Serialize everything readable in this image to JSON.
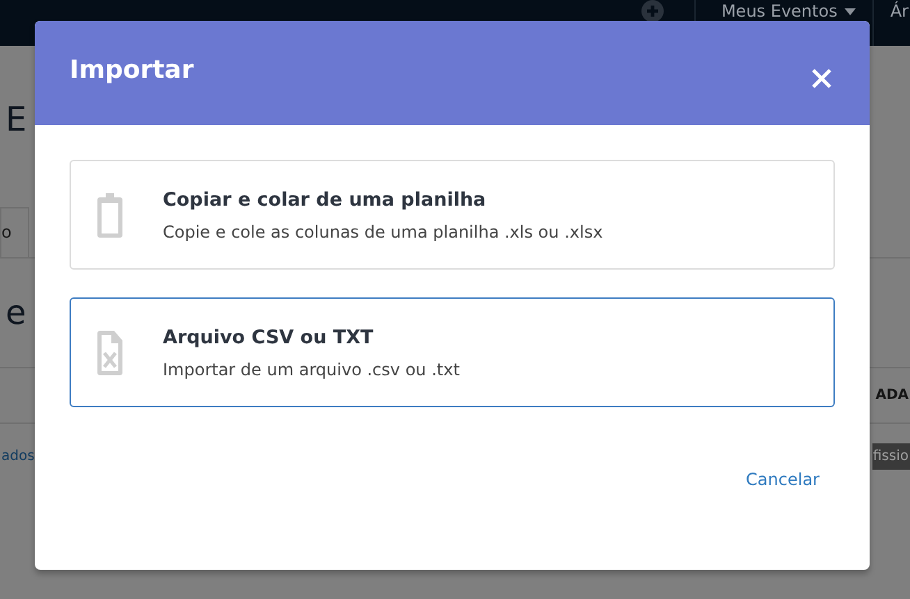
{
  "navbar": {
    "menu_label": "Meus Eventos",
    "cut_item": "Ár"
  },
  "background": {
    "heading": "E",
    "subheading": "e",
    "tab": "o",
    "column_header": "ADA",
    "link": "ados",
    "badge": "fissio"
  },
  "dialog": {
    "title": "Importar",
    "options": [
      {
        "kind": "clipboard",
        "title": "Copiar e colar de uma planilha",
        "description": "Copie e cole as colunas de uma planilha .xls ou .xlsx",
        "selected": false
      },
      {
        "kind": "file",
        "title": "Arquivo CSV ou TXT",
        "description": "Importar de um arquivo .csv ou .txt",
        "selected": true
      }
    ],
    "cancel": "Cancelar"
  }
}
